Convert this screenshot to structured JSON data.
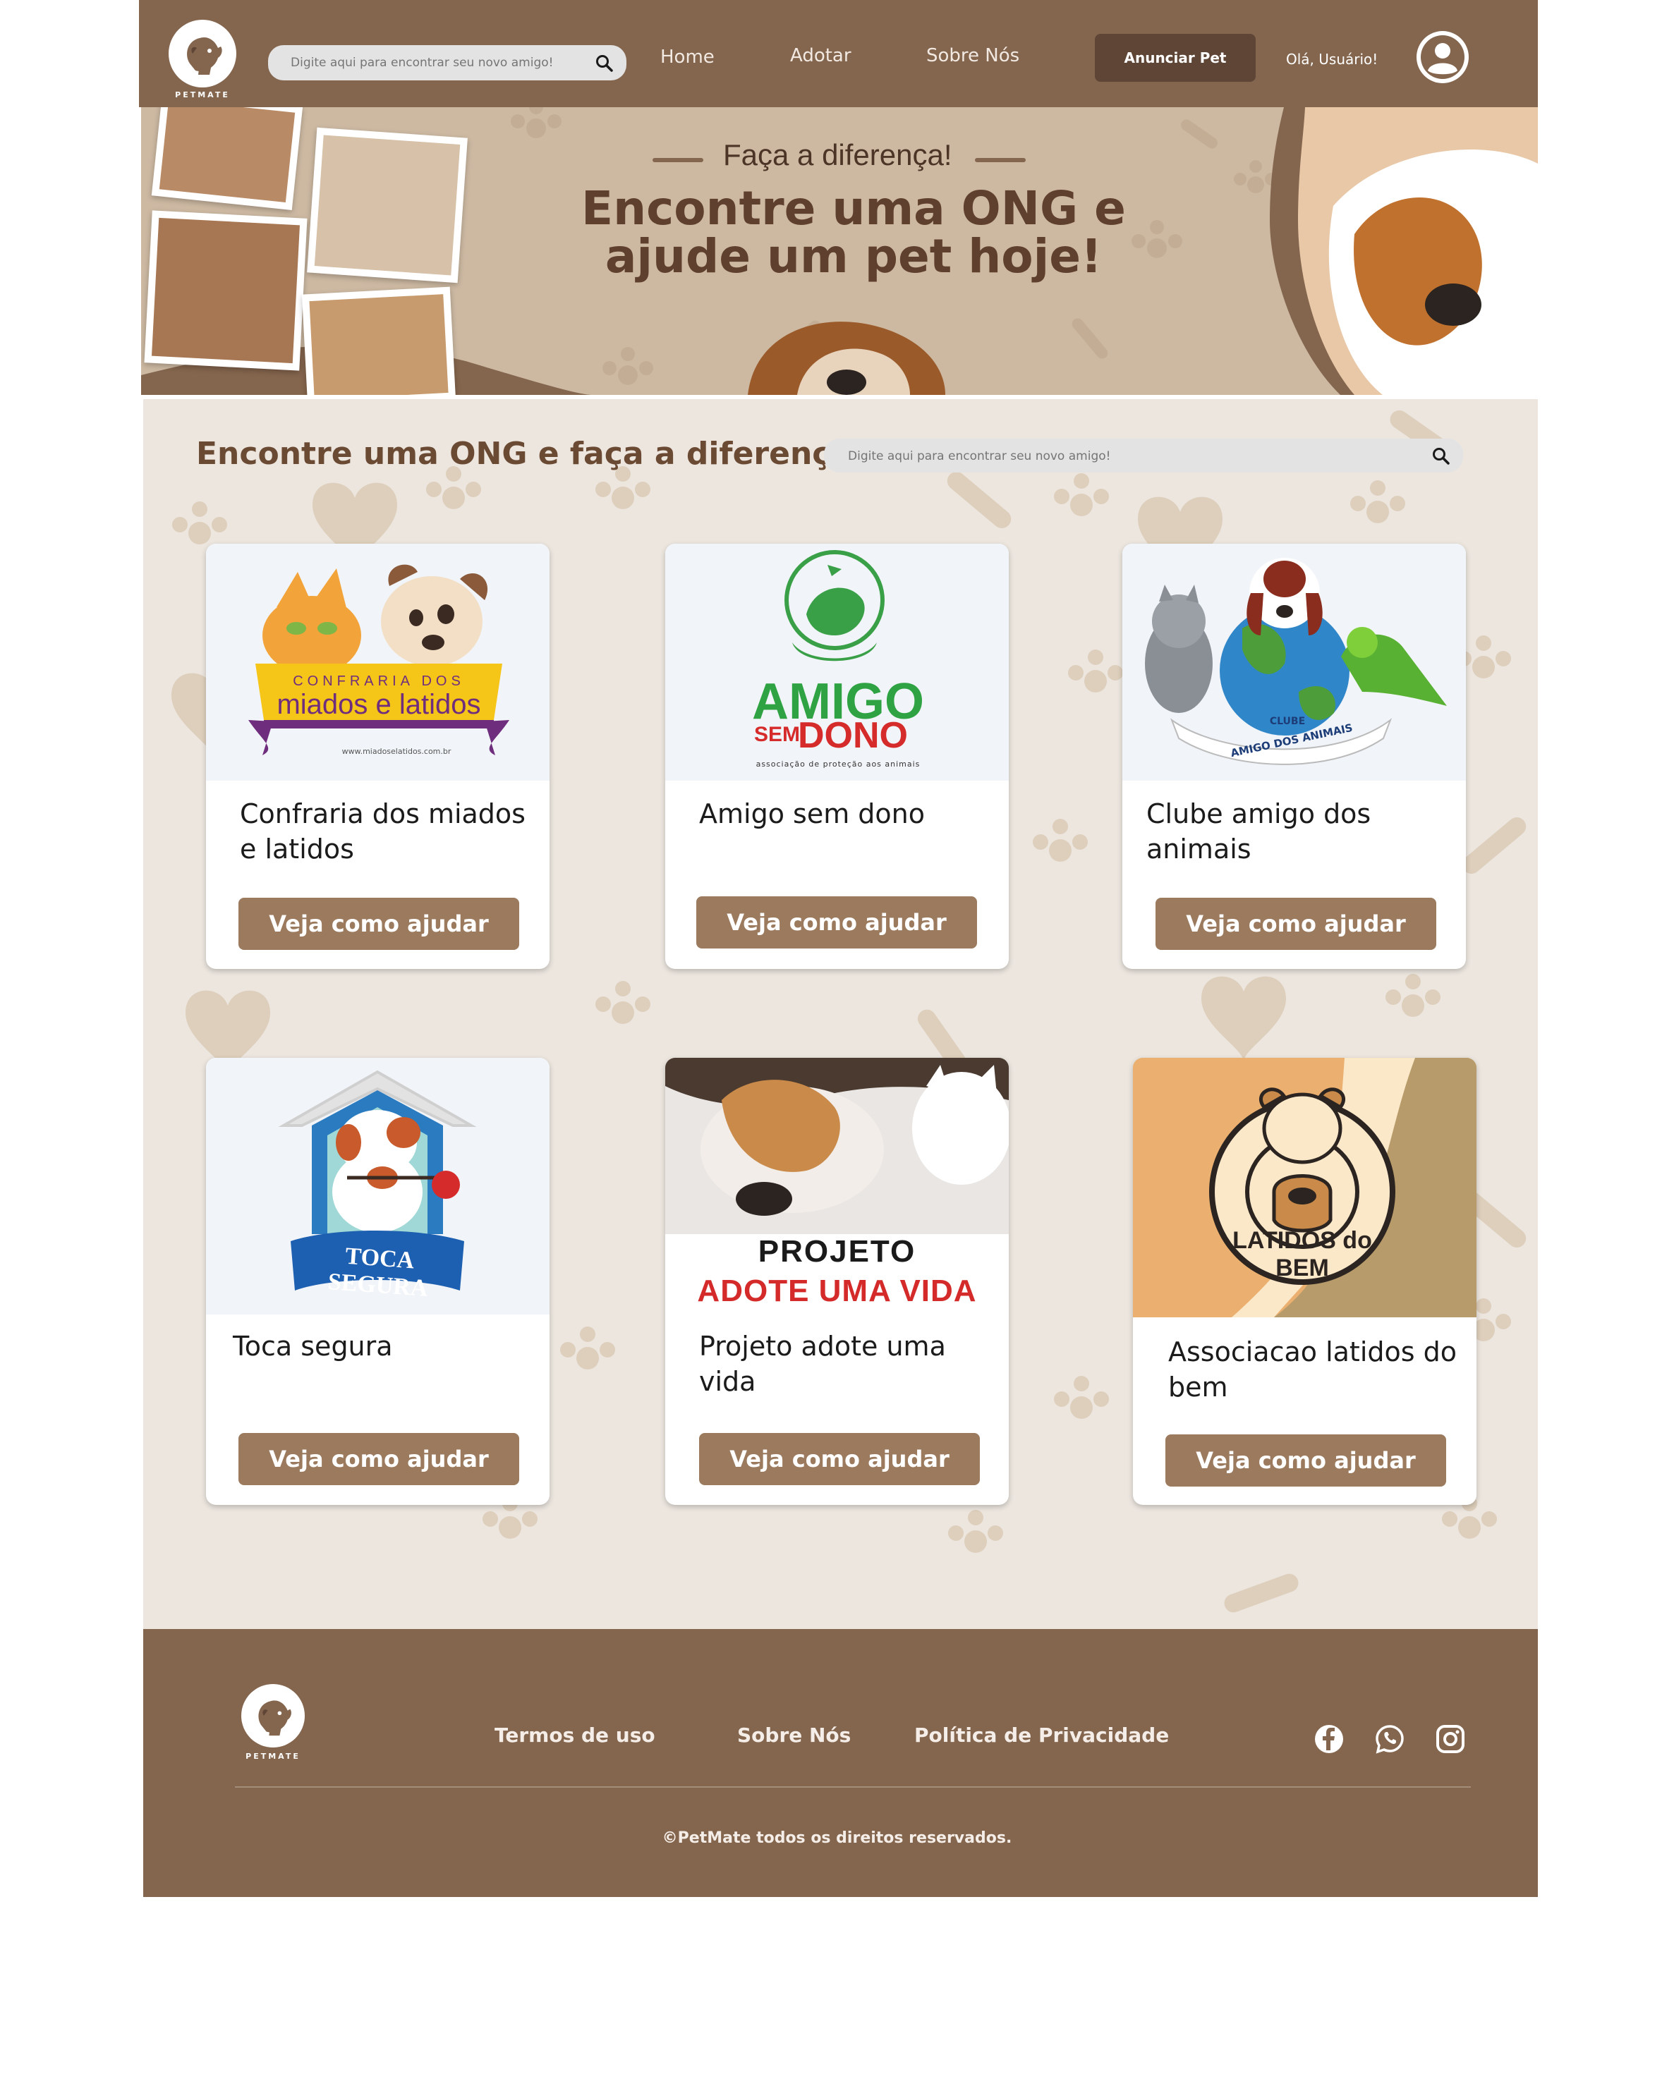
{
  "header": {
    "logo_text": "PETMATE",
    "search_placeholder": "Digite aqui para encontrar seu novo amigo!",
    "nav": [
      "Home",
      "Adotar",
      "Sobre Nós"
    ],
    "announce_label": "Anunciar Pet",
    "greeting": "Olá, Usuário!"
  },
  "hero": {
    "kicker": "Faça a diferença!",
    "title": "Encontre uma ONG e ajude um pet hoje!"
  },
  "main": {
    "title": "Encontre uma ONG e faça a diferença!",
    "search_placeholder": "Digite aqui para encontrar seu novo amigo!"
  },
  "orgs": [
    {
      "name": "Confraria dos miados e latidos",
      "button": "Veja como ajudar",
      "logo_top": "CONFRARIA DOS",
      "logo_main": "miados e latidos",
      "logo_url": "www.miadoselatidos.com.br"
    },
    {
      "name": "Amigo sem dono",
      "button": "Veja como ajudar",
      "logo_top": "AMIGO",
      "logo_mid": "SEM",
      "logo_main": "DONO",
      "logo_sub": "associação de proteção aos animais"
    },
    {
      "name": "Clube amigo dos animais",
      "button": "Veja como ajudar",
      "logo_top": "CLUBE",
      "logo_main": "AMIGO DOS ANIMAIS"
    },
    {
      "name": "Toca segura",
      "button": "Veja como ajudar",
      "logo_main": "TOCA SEGURA"
    },
    {
      "name": "Projeto adote uma vida",
      "button": "Veja como ajudar",
      "logo_top": "PROJETO",
      "logo_main": "ADOTE UMA VIDA"
    },
    {
      "name": "Associacao latidos do bem",
      "button": "Veja como ajudar",
      "logo_main": "LATIDOS do BEM"
    }
  ],
  "footer": {
    "logo_text": "PETMATE",
    "links": [
      "Termos de uso",
      "Sobre Nós",
      "Política de Privacidade"
    ],
    "copyright": "©PetMate todos os direitos reservados."
  },
  "colors": {
    "brand_brown": "#84654d",
    "dark_brown": "#5f4535",
    "button_brown": "#9b7a5e",
    "hero_beige": "#cdb9a2",
    "page_beige": "#ece6df",
    "title_brown": "#6b4a33"
  },
  "icons": [
    "dog-cat-logo-icon",
    "search-icon",
    "user-avatar-icon",
    "facebook-icon",
    "whatsapp-icon",
    "instagram-icon",
    "paw-icon",
    "bone-icon"
  ]
}
